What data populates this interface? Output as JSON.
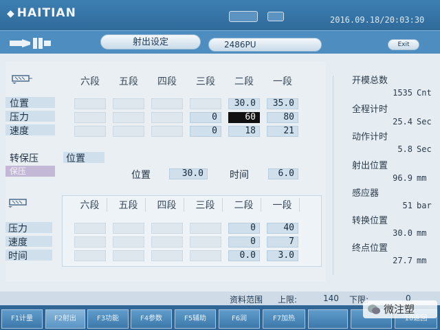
{
  "header": {
    "brand": "HAITIAN",
    "datetime": "2016.09.18/20:03:30"
  },
  "subheader": {
    "title": "射出设定",
    "mold": "2486PU",
    "exit_label": "Exit"
  },
  "injection": {
    "stage_headers": [
      "六段",
      "五段",
      "四段",
      "三段",
      "二段",
      "一段"
    ],
    "rows": [
      {
        "label": "位置",
        "values": [
          "",
          "",
          "",
          "",
          "30.0",
          "35.0"
        ]
      },
      {
        "label": "压力",
        "values": [
          "",
          "",
          "",
          "0",
          "60",
          "80"
        ]
      },
      {
        "label": "速度",
        "values": [
          "",
          "",
          "",
          "0",
          "18",
          "21"
        ]
      }
    ],
    "transfer_label": "转保压",
    "transfer_mode": "位置",
    "transfer_sub": "保压",
    "position_label": "位置",
    "position_value": "30.0",
    "time_label": "时间",
    "time_value": "6.0"
  },
  "hold": {
    "stage_headers": [
      "六段",
      "五段",
      "四段",
      "三段",
      "二段",
      "一段"
    ],
    "rows": [
      {
        "label": "压力",
        "values": [
          "",
          "",
          "",
          "",
          "0",
          "40"
        ]
      },
      {
        "label": "速度",
        "values": [
          "",
          "",
          "",
          "",
          "0",
          "7"
        ]
      },
      {
        "label": "时间",
        "values": [
          "",
          "",
          "",
          "",
          "0.0",
          "3.0"
        ]
      }
    ]
  },
  "status": [
    {
      "label": "开模总数",
      "value": "1535",
      "unit": "Cnt"
    },
    {
      "label": "全程计时",
      "value": "25.4",
      "unit": "Sec"
    },
    {
      "label": "动作计时",
      "value": "5.8",
      "unit": "Sec"
    },
    {
      "label": "射出位置",
      "value": "96.9",
      "unit": "mm"
    },
    {
      "label": "感应器",
      "value": "51",
      "unit": "bar"
    },
    {
      "label": "转换位置",
      "value": "30.0",
      "unit": "mm"
    },
    {
      "label": "终点位置",
      "value": "27.7",
      "unit": "mm"
    }
  ],
  "range": {
    "label": "资料范围",
    "upper_label": "上限:",
    "upper_value": "140",
    "lower_label": "下限:",
    "lower_value": "0"
  },
  "fkeys": [
    "F1计量",
    "F2射出",
    "F3功能",
    "F4参数",
    "F5辅助",
    "F6润",
    "F7加热",
    "",
    "",
    "10返回"
  ],
  "watermark": "微注塑"
}
